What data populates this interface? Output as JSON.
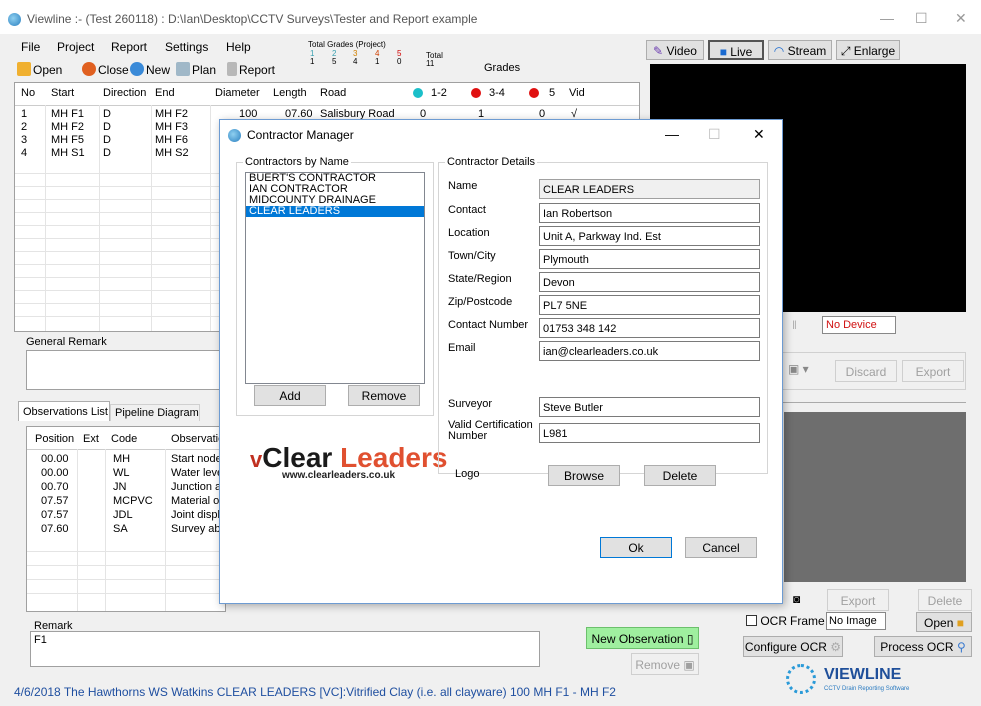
{
  "window": {
    "title": "Viewline :- (Test 260118) : D:\\Ian\\Desktop\\CCTV Surveys\\Tester and Report example",
    "min": "—",
    "max": "☐",
    "close": "✕"
  },
  "menu": [
    "File",
    "Project",
    "Report",
    "Settings",
    "Help"
  ],
  "toolbar": {
    "open": "Open",
    "close": "Close",
    "new": "New",
    "plan": "Plan",
    "report": "Report"
  },
  "grades_summary": {
    "title": "Total Grades (Project)",
    "grades": [
      "1",
      "2",
      "3",
      "4",
      "5"
    ],
    "counts": [
      "1",
      "5",
      "4",
      "1",
      "0"
    ],
    "total_label": "Total",
    "total": "11",
    "grades_label": "Grades"
  },
  "right_toolbar": {
    "video": "Video",
    "live": "Live",
    "stream": "Stream",
    "enlarge": "Enlarge"
  },
  "pipes_table": {
    "headers": [
      "No",
      "Start",
      "Direction",
      "End",
      "Diameter",
      "Length",
      "Road",
      "1-2",
      "3-4",
      "5",
      "Vid"
    ],
    "rows": [
      {
        "no": "1",
        "start": "MH F1",
        "dir": "D",
        "end": "MH F2",
        "dia": "100",
        "len": "07.60",
        "road": "Salisbury Road",
        "g12": "0",
        "g34": "1",
        "g5": "0",
        "vid": "√"
      },
      {
        "no": "2",
        "start": "MH F2",
        "dir": "D",
        "end": "MH F3"
      },
      {
        "no": "3",
        "start": "MH F5",
        "dir": "D",
        "end": "MH F6"
      },
      {
        "no": "4",
        "start": "MH S1",
        "dir": "D",
        "end": "MH S2"
      }
    ]
  },
  "general_remark": {
    "label": "General Remark"
  },
  "tabs": {
    "observations": "Observations List",
    "pipeline": "Pipeline Diagram"
  },
  "obs_table": {
    "headers": [
      "Position",
      "Ext",
      "Code",
      "Observatio"
    ],
    "rows": [
      {
        "pos": "00.00",
        "ext": "",
        "code": "MH",
        "obs": "Start node"
      },
      {
        "pos": "00.00",
        "ext": "",
        "code": "WL",
        "obs": "Water leve"
      },
      {
        "pos": "00.70",
        "ext": "",
        "code": "JN",
        "obs": "Junction at"
      },
      {
        "pos": "07.57",
        "ext": "",
        "code": "MCPVC",
        "obs": "Material of"
      },
      {
        "pos": "07.57",
        "ext": "",
        "code": "JDL",
        "obs": "Joint displa"
      },
      {
        "pos": "07.60",
        "ext": "",
        "code": "SA",
        "obs": "Survey aba"
      }
    ]
  },
  "remark": {
    "label": "Remark",
    "value": "F1"
  },
  "new_observation": "New Observation",
  "remove_obs": "Remove",
  "video_panel": {
    "no_device": "No Device",
    "pause": "‖",
    "discard": "Discard",
    "export": "Export",
    "export2": "Export",
    "delete": "Delete",
    "ocr": "OCR",
    "frame": "Frame",
    "no_image": "No Image",
    "open": "Open",
    "configure_ocr": "Configure OCR",
    "process_ocr": "Process OCR"
  },
  "brand": {
    "name": "VIEWLINE",
    "tagline": "CCTV Drain Reporting Software"
  },
  "status_bar": "4/6/2018  The Hawthorns  WS Watkins  CLEAR LEADERS  [VC]:Vitrified Clay (i.e. all clayware) 100  MH F1 - MH F2",
  "dialog": {
    "title": "Contractor Manager",
    "min": "—",
    "max": "☐",
    "close": "✕",
    "list_label": "Contractors by Name",
    "contractors": [
      "BUERT'S CONTRACTOR",
      "IAN CONTRACTOR",
      "MIDCOUNTY DRAINAGE",
      "CLEAR LEADERS"
    ],
    "selected_index": 3,
    "add": "Add",
    "remove": "Remove",
    "details_label": "Contractor Details",
    "fields": {
      "name": {
        "label": "Name",
        "value": "CLEAR LEADERS"
      },
      "contact": {
        "label": "Contact",
        "value": "Ian Robertson"
      },
      "location": {
        "label": "Location",
        "value": "Unit A, Parkway Ind. Est"
      },
      "town": {
        "label": "Town/City",
        "value": "Plymouth"
      },
      "state": {
        "label": "State/Region",
        "value": "Devon"
      },
      "zip": {
        "label": "Zip/Postcode",
        "value": "PL7 5NE"
      },
      "phone": {
        "label": "Contact Number",
        "value": "01753 348 142"
      },
      "email": {
        "label": "Email",
        "value": "ian@clearleaders.co.uk"
      },
      "surveyor": {
        "label": "Surveyor",
        "value": "Steve Butler"
      },
      "cert_line1": {
        "label": "Valid Certification",
        "value": "L981"
      },
      "cert_line2": {
        "label": "Number"
      }
    },
    "logo_label": "Logo",
    "browse": "Browse",
    "delete": "Delete",
    "ok": "Ok",
    "cancel": "Cancel",
    "logo": {
      "word1": "Clear",
      "word2": "Leaders",
      "url": "www.clearleaders.co.uk"
    }
  },
  "colors": {
    "grade12": "#1bbfc9",
    "grade34": "#e01010",
    "grade5": "#e01010",
    "selection": "#0078d7",
    "status_text": "#1f4fa0",
    "new_obs_bg": "#9fef9f"
  }
}
